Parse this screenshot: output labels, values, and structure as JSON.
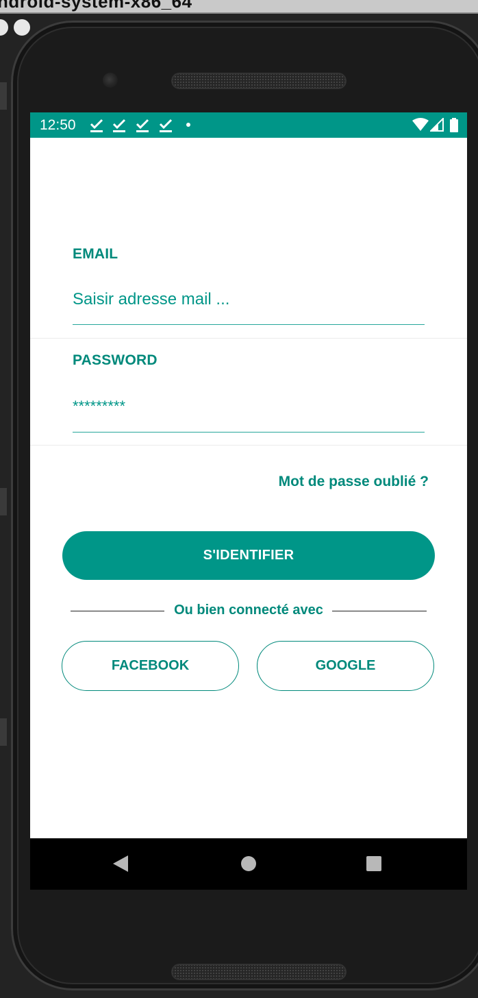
{
  "window": {
    "title": "ndroid-system-x86_64"
  },
  "status_bar": {
    "time": "12:50",
    "color": "#009688",
    "notification_icons": [
      "download-done-icon",
      "download-done-icon",
      "download-done-icon",
      "download-done-icon"
    ]
  },
  "login": {
    "email": {
      "label": "EMAIL",
      "placeholder": "Saisir adresse mail ..."
    },
    "password": {
      "label": "PASSWORD",
      "value": "*********"
    },
    "forgot_link": "Mot de passe oublié ?",
    "submit_label": "S'IDENTIFIER",
    "separator_text": "Ou bien connecté avec",
    "facebook_label": "FACEBOOK",
    "google_label": "GOOGLE"
  },
  "nav_bar": {
    "icons": [
      "back-icon",
      "home-icon",
      "recents-icon"
    ]
  },
  "colors": {
    "accent": "#009688",
    "accent_dark": "#00897b",
    "background": "#ffffff"
  }
}
